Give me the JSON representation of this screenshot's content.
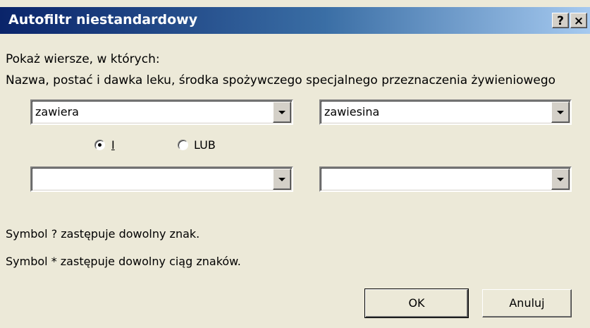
{
  "window": {
    "title": "Autofiltr niestandardowy",
    "help_glyph": "?",
    "close_glyph": "×"
  },
  "content": {
    "prompt": "Pokaż wiersze, w których:",
    "column_label": "Nazwa, postać i dawka leku, środka spożywczego specjalnego przeznaczenia żywieniowego"
  },
  "criteria": {
    "row1": {
      "operator": "zawiera",
      "value": "zawiesina"
    },
    "logic": {
      "and_label": "I",
      "or_label": "LUB",
      "selected": "I"
    },
    "row2": {
      "operator": "",
      "value": ""
    }
  },
  "hints": {
    "line1": "Symbol ? zastępuje dowolny znak.",
    "line2": "Symbol * zastępuje dowolny ciąg znaków."
  },
  "buttons": {
    "ok": "OK",
    "cancel": "Anuluj"
  },
  "colors": {
    "titlebar_start": "#0a246a",
    "titlebar_end": "#a6caf0",
    "dialog_face": "#ece9d8"
  }
}
